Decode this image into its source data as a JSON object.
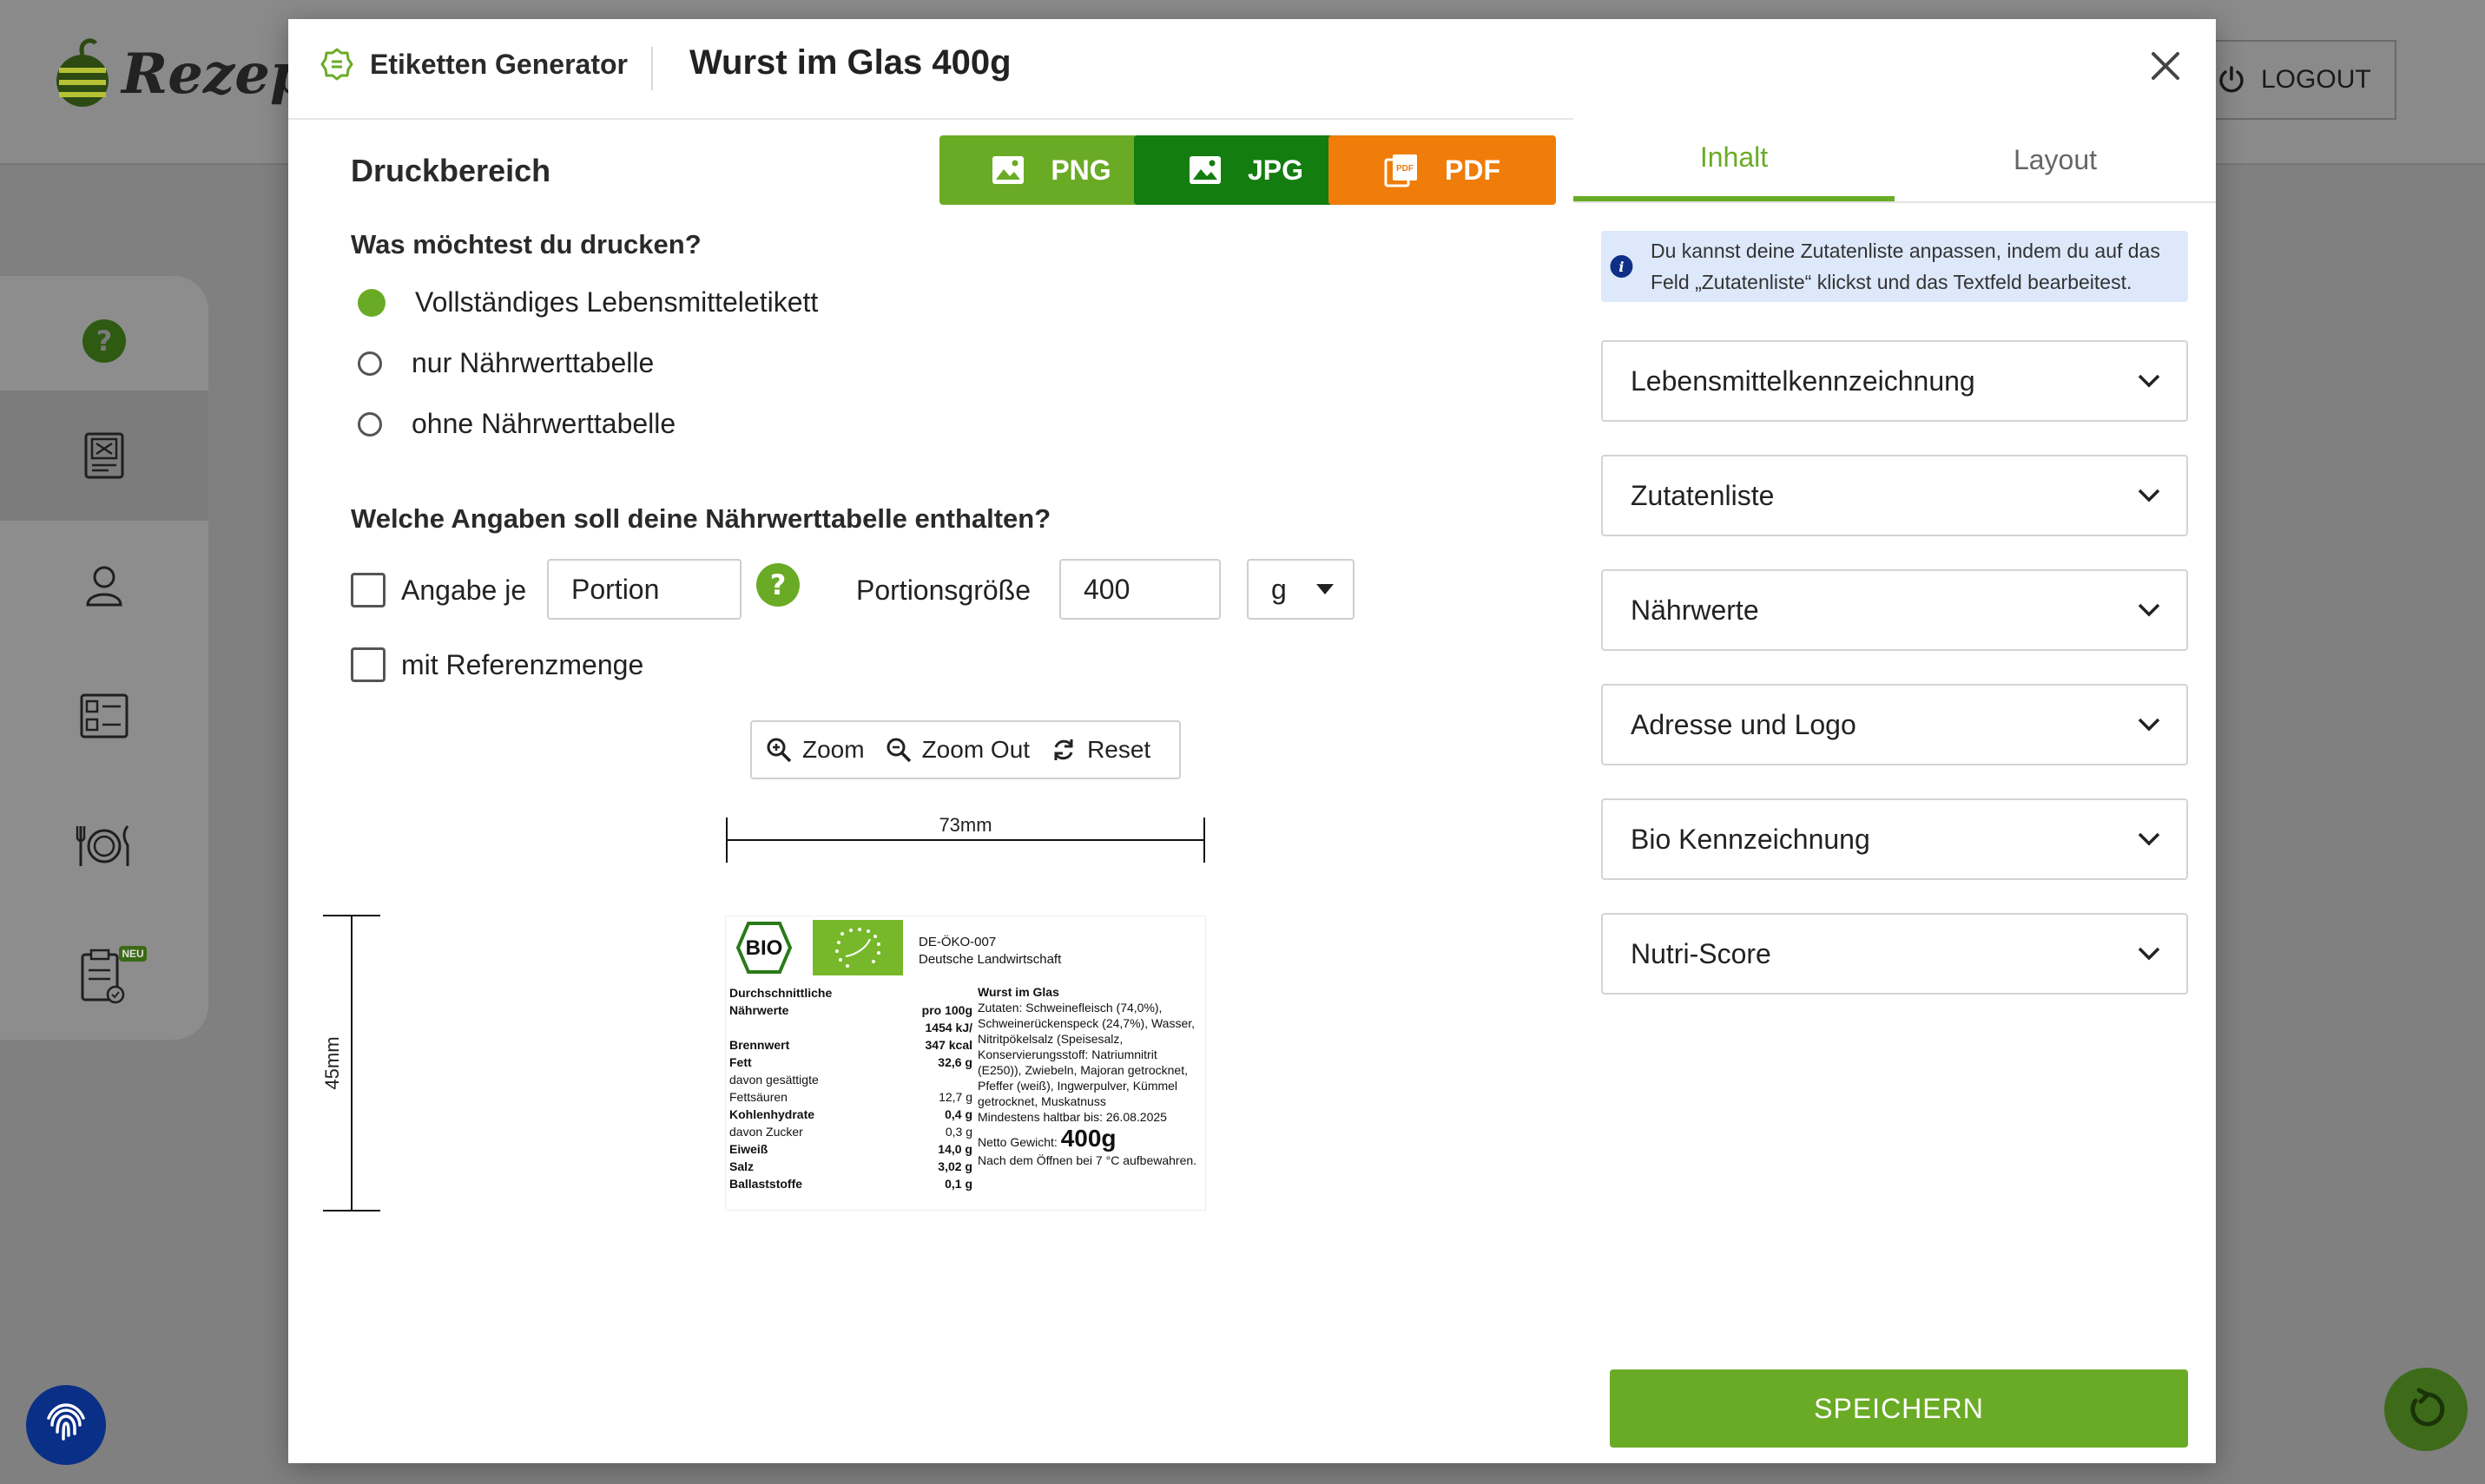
{
  "app": {
    "logo_text": "Rezeptr",
    "logout_label": "LOGOUT",
    "sidebar": [
      {
        "icon": "help-icon"
      },
      {
        "icon": "label-generator-icon"
      },
      {
        "icon": "user-icon"
      },
      {
        "icon": "checklist-icon"
      },
      {
        "icon": "plate-cutlery-icon"
      },
      {
        "icon": "clipboard-icon",
        "badge": "NEU"
      }
    ]
  },
  "modal": {
    "module": "Etiketten Generator",
    "title": "Wurst im Glas 400g",
    "left": {
      "section_title": "Druckbereich",
      "export_buttons": [
        {
          "label": "PNG",
          "color": "#6aab26"
        },
        {
          "label": "JPG",
          "color": "#137d10"
        },
        {
          "label": "PDF",
          "color": "#f07c0a"
        }
      ],
      "print_question": "Was möchtest du drucken?",
      "print_options": [
        {
          "label": "Vollständiges Lebensmitteletikett",
          "selected": true
        },
        {
          "label": "nur Nährwerttabelle",
          "selected": false
        },
        {
          "label": "ohne Nährwerttabelle",
          "selected": false
        }
      ],
      "nutrition_question": "Welche Angaben soll deine Nährwerttabelle enthalten?",
      "per_label": "Angabe je",
      "per_value": "Portion",
      "portion_label": "Portionsgröße",
      "portion_value": "400",
      "unit_value": "g",
      "reference_label": "mit Referenzmenge",
      "zoom": {
        "zoom_in": "Zoom",
        "zoom_out": "Zoom Out",
        "reset": "Reset"
      },
      "width_label": "73mm",
      "height_label": "45mm"
    },
    "label_preview": {
      "bio_text": "BIO",
      "code_line1": "DE-ÖKO-007",
      "code_line2": "Deutsche Landwirtschaft",
      "nut_heading1": "Durchschnittliche",
      "nut_heading2": "Nährwerte",
      "per_100g": "pro 100g",
      "rows": [
        {
          "name": "",
          "value": "1454 kJ/",
          "bold": true
        },
        {
          "name": "Brennwert",
          "value": "347 kcal",
          "bold": true
        },
        {
          "name": "Fett",
          "value": "32,6 g",
          "bold": true
        },
        {
          "name": "davon gesättigte",
          "value": "",
          "bold": false
        },
        {
          "name": "Fettsäuren",
          "value": "12,7 g",
          "bold": false
        },
        {
          "name": "Kohlenhydrate",
          "value": "0,4 g",
          "bold": true
        },
        {
          "name": "davon Zucker",
          "value": "0,3 g",
          "bold": false
        },
        {
          "name": "Eiweiß",
          "value": "14,0 g",
          "bold": true
        },
        {
          "name": "Salz",
          "value": "3,02 g",
          "bold": true
        },
        {
          "name": "Ballaststoffe",
          "value": "0,1 g",
          "bold": true
        }
      ],
      "product_name": "Wurst im Glas",
      "ingredients": "Zutaten: Schweinefleisch (74,0%), Schweinerückenspeck (24,7%), Wasser, Nitritpökelsalz (Speisesalz, Konservierungsstoff: Natriumnitrit (E250)), Zwiebeln, Majoran getrocknet, Pfeffer (weiß), Ingwerpulver, Kümmel getrocknet, Muskatnuss",
      "best_before": "Mindestens haltbar bis: 26.08.2025",
      "net_weight_label": "Netto Gewicht:",
      "net_weight_value": "400g",
      "storage": "Nach dem Öffnen bei 7 °C aufbewahren."
    },
    "right": {
      "tabs": [
        {
          "label": "Inhalt",
          "active": true
        },
        {
          "label": "Layout",
          "active": false
        }
      ],
      "info_text": "Du kannst deine Zutatenliste anpassen, indem du auf das Feld „Zutatenliste“ klickst und das Textfeld bearbeitest.",
      "sections": [
        "Lebensmittelkennzeichnung",
        "Zutatenliste",
        "Nährwerte",
        "Adresse und Logo",
        "Bio Kennzeichnung",
        "Nutri-Score"
      ],
      "save_label": "SPEICHERN"
    }
  }
}
